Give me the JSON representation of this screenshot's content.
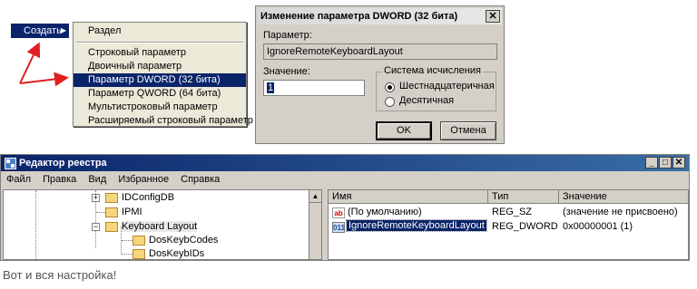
{
  "context_menu": {
    "parent_label": "Создать",
    "items": [
      "Раздел",
      "Строковый параметр",
      "Двоичный параметр",
      "Параметр DWORD (32 бита)",
      "Параметр QWORD (64 бита)",
      "Мультистроковый параметр",
      "Расширяемый строковый параметр"
    ],
    "selected_index": 3
  },
  "dialog": {
    "title": "Изменение параметра DWORD (32 бита)",
    "param_label": "Параметр:",
    "param_value": "IgnoreRemoteKeyboardLayout",
    "value_label": "Значение:",
    "value": "1",
    "radix_label": "Система исчисления",
    "radix_options": [
      "Шестнадцатеричная",
      "Десятичная"
    ],
    "radix_selected": 0,
    "ok_label": "OK",
    "cancel_label": "Отмена"
  },
  "regedit": {
    "title": "Редактор реестра",
    "menu": [
      "Файл",
      "Правка",
      "Вид",
      "Избранное",
      "Справка"
    ],
    "tree": [
      "IDConfigDB",
      "IPMI",
      "Keyboard Layout",
      "DosKeybCodes",
      "DosKeybIDs"
    ],
    "columns": [
      "Имя",
      "Тип",
      "Значение"
    ],
    "rows": [
      {
        "name": "(По умолчанию)",
        "type": "REG_SZ",
        "value": "(значение не присвоено)"
      },
      {
        "name": "IgnoreRemoteKeyboardLayout",
        "type": "REG_DWORD",
        "value": "0x00000001 (1)"
      }
    ]
  },
  "caption": "Вот и вся настройка!",
  "colors": {
    "selection": "#0a246a",
    "arrow": "#e02020"
  }
}
